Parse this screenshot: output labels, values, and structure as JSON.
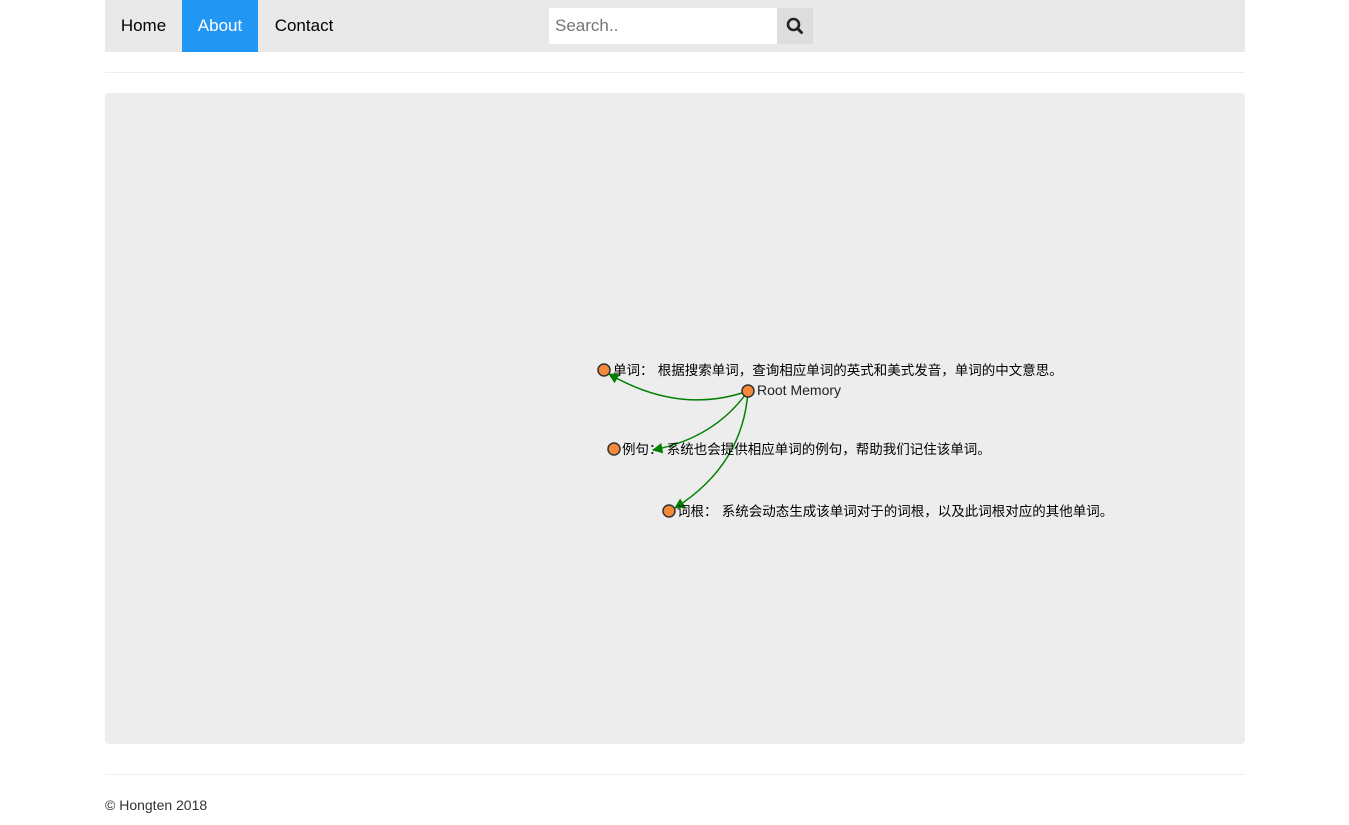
{
  "nav": {
    "items": [
      {
        "label": "Home",
        "active": false
      },
      {
        "label": "About",
        "active": true
      },
      {
        "label": "Contact",
        "active": false
      }
    ],
    "active_color": "#2196F3",
    "background": "#e9e9e9"
  },
  "search": {
    "placeholder": "Search..",
    "value": "",
    "button_icon": "search-icon"
  },
  "graph": {
    "root": {
      "label": "Root Memory"
    },
    "children": [
      {
        "label": "单词： 根据搜索单词，查询相应单词的英式和美式发音，单词的中文意思。"
      },
      {
        "label": "例句： 系统也会提供相应单词的例句，帮助我们记住该单词。"
      },
      {
        "label": "词根： 系统会动态生成该单词对于的词根，以及此词根对应的其他单词。"
      }
    ],
    "node_color": "#f4893a",
    "link_color": "#008000"
  },
  "footer": {
    "text": "© Hongten 2018"
  }
}
